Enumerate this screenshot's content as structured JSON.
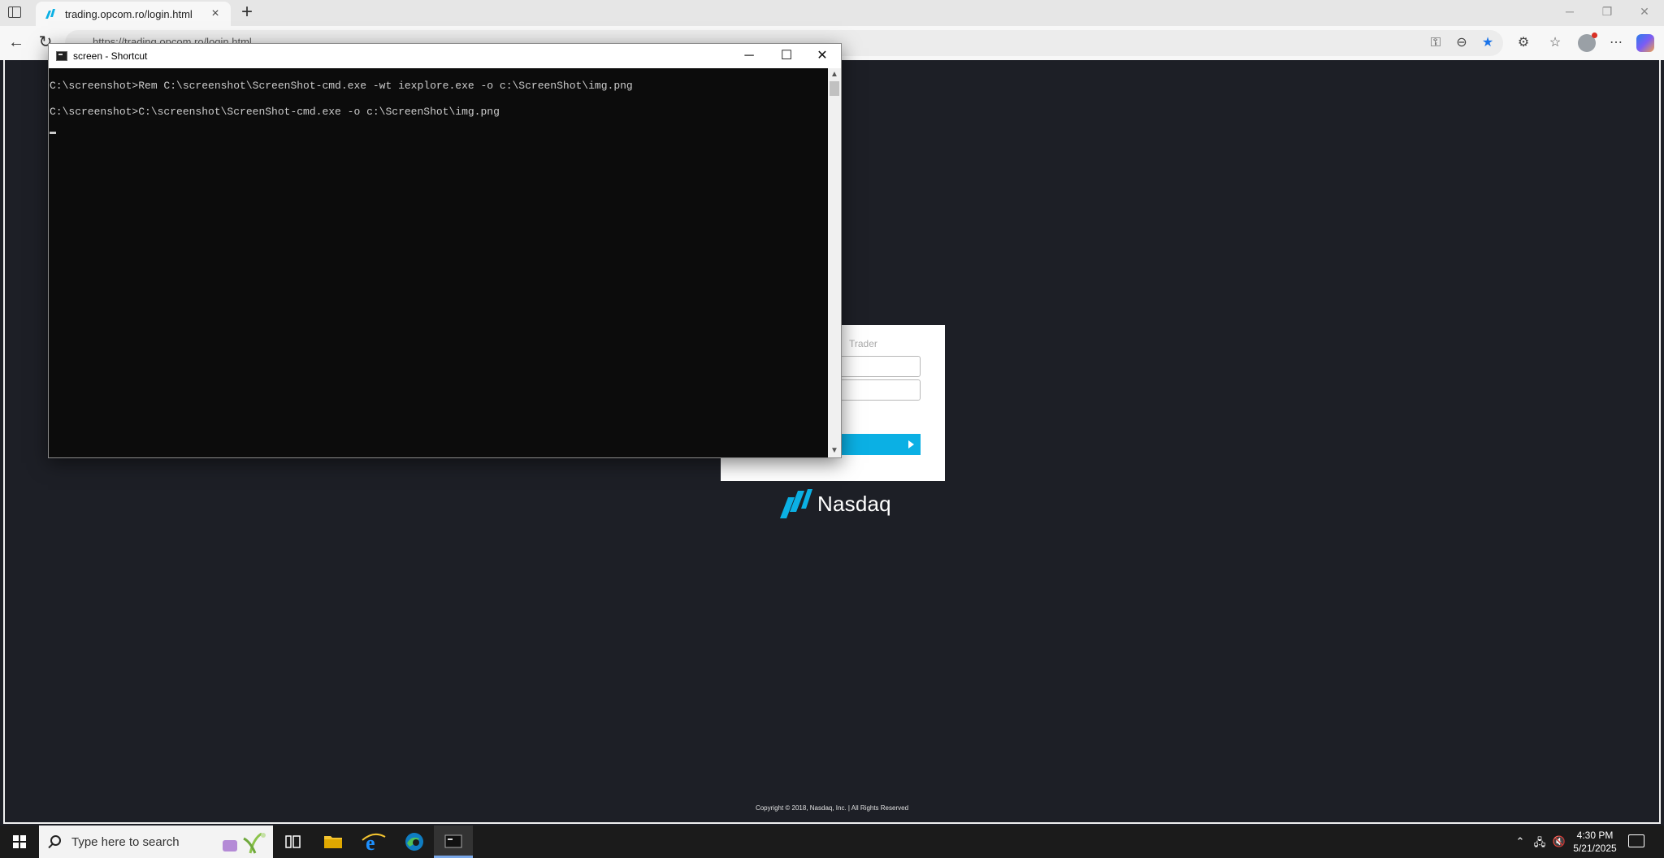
{
  "browser": {
    "tab_title": "trading.opcom.ro/login.html",
    "tab_close": "×",
    "new_tab": "+",
    "address": "https://trading.opcom.ro/login.html",
    "icons": [
      "tab-actions-icon",
      "back-icon",
      "refresh-icon",
      "key-icon",
      "zoom-icon",
      "favorite-star-icon",
      "extensions-icon",
      "favorites-icon",
      "profile-icon",
      "more-icon",
      "copilot-icon"
    ],
    "accent": "#1a73e8"
  },
  "console": {
    "title": "screen - Shortcut",
    "lines": [
      "C:\\screenshot>Rem C:\\screenshot\\ScreenShot-cmd.exe -wt iexplore.exe -o c:\\ScreenShot\\img.png",
      "C:\\screenshot>C:\\screenshot\\ScreenShot-cmd.exe -o c:\\ScreenShot\\img.png"
    ],
    "controls": {
      "minimize": "─",
      "maximize": "☐",
      "close": "✕"
    },
    "scroll_up": "▲",
    "scroll_down": "▼"
  },
  "login": {
    "heading": "Trader",
    "button_color": "#0bb0e4"
  },
  "brand": {
    "name": "Nasdaq",
    "logo_color": "#0bb0e4"
  },
  "footer": {
    "copyright": "Copyright © 2018, Nasdaq, Inc. | All Rights Reserved"
  },
  "taskbar": {
    "search_placeholder": "Type here to search",
    "time": "4:30 PM",
    "date": "5/21/2025",
    "tray_chevron": "⌃",
    "apps": [
      "task-view-icon",
      "file-explorer-icon",
      "internet-explorer-icon",
      "edge-icon",
      "console-app-icon"
    ]
  }
}
